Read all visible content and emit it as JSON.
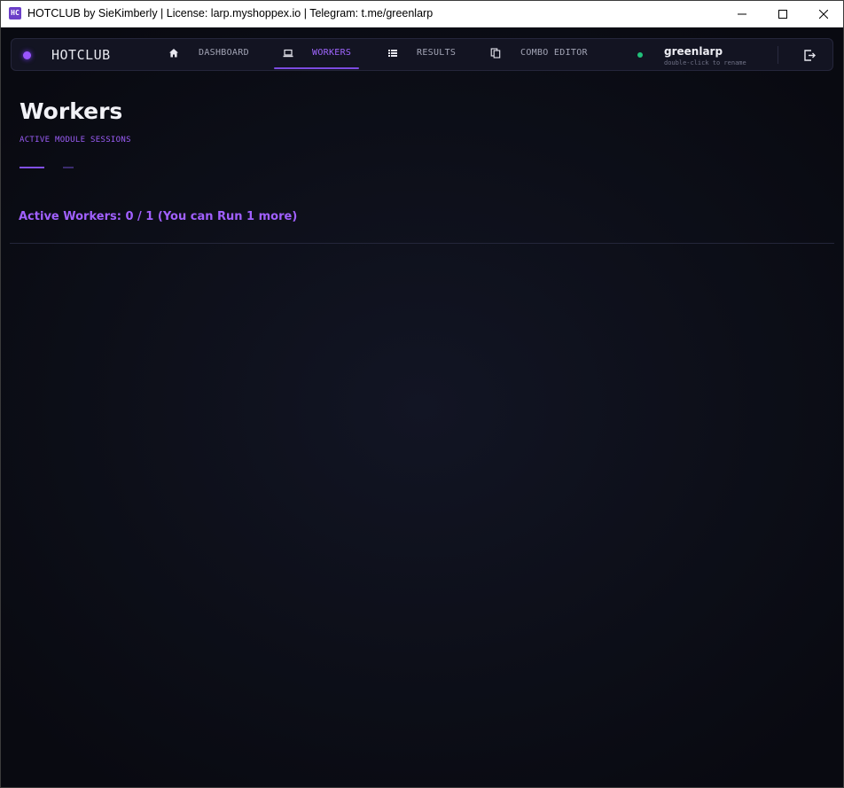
{
  "window": {
    "title": "HOTCLUB by SieKimberly | License: larp.myshoppex.io | Telegram: t.me/greenlarp",
    "icon_text": "HC",
    "controls": [
      "minimize",
      "maximize",
      "close"
    ]
  },
  "navbar": {
    "brand": "HOTCLUB",
    "items": [
      {
        "label": "DASHBOARD",
        "icon": "home-icon",
        "active": false
      },
      {
        "label": "WORKERS",
        "icon": "laptop-icon",
        "active": true
      },
      {
        "label": "RESULTS",
        "icon": "list-icon",
        "active": false
      },
      {
        "label": "COMBO EDITOR",
        "icon": "copy-icon",
        "active": false
      }
    ],
    "user": {
      "name": "greenlarp",
      "hint": "double-click to rename",
      "status_color": "#21c07a"
    },
    "logout_icon": "logout-icon"
  },
  "page": {
    "title": "Workers",
    "subtitle": "ACTIVE MODULE SESSIONS",
    "workers_status": "Active Workers: 0 / 1 (You can Run 1 more)"
  },
  "colors": {
    "accent": "#a066ff",
    "background": "#0a0b12",
    "navbar_bg": "#131422"
  }
}
